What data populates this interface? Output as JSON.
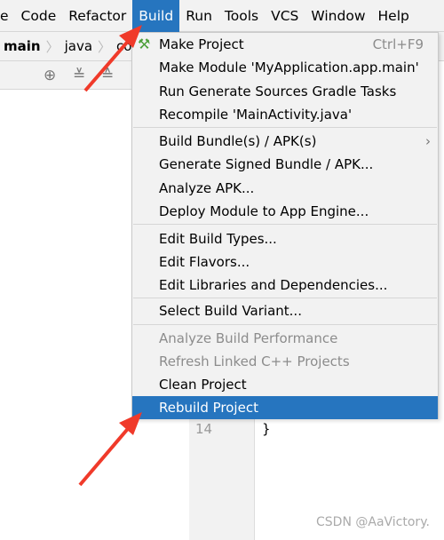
{
  "menubar": {
    "items": [
      "e",
      "Code",
      "Refactor",
      "Build",
      "Run",
      "Tools",
      "VCS",
      "Window",
      "Help"
    ],
    "active": "Build"
  },
  "breadcrumb": [
    "main",
    "java",
    "com"
  ],
  "toolbar": {
    "icons": [
      "locate-icon",
      "expand-all-icon",
      "collapse-all-icon"
    ]
  },
  "editor": {
    "line_number": "14",
    "code": "}"
  },
  "build_menu": {
    "groups": [
      [
        {
          "label": "Make Project",
          "shortcut": "Ctrl+F9",
          "icon": "hammer-icon"
        },
        {
          "label": "Make Module 'MyApplication.app.main'"
        },
        {
          "label": "Run Generate Sources Gradle Tasks"
        },
        {
          "label": "Recompile 'MainActivity.java'"
        }
      ],
      [
        {
          "label": "Build Bundle(s) / APK(s)",
          "submenu": true
        },
        {
          "label": "Generate Signed Bundle / APK..."
        },
        {
          "label": "Analyze APK..."
        },
        {
          "label": "Deploy Module to App Engine..."
        }
      ],
      [
        {
          "label": "Edit Build Types..."
        },
        {
          "label": "Edit Flavors..."
        },
        {
          "label": "Edit Libraries and Dependencies..."
        }
      ],
      [
        {
          "label": "Select Build Variant..."
        }
      ],
      [
        {
          "label": "Analyze Build Performance",
          "disabled": true
        },
        {
          "label": "Refresh Linked C++ Projects",
          "disabled": true
        },
        {
          "label": "Clean Project"
        },
        {
          "label": "Rebuild Project",
          "selected": true
        }
      ]
    ]
  },
  "watermark": "CSDN @AaVictory.",
  "colors": {
    "selection": "#2675bf",
    "annotation_arrow": "#f03a2a"
  }
}
